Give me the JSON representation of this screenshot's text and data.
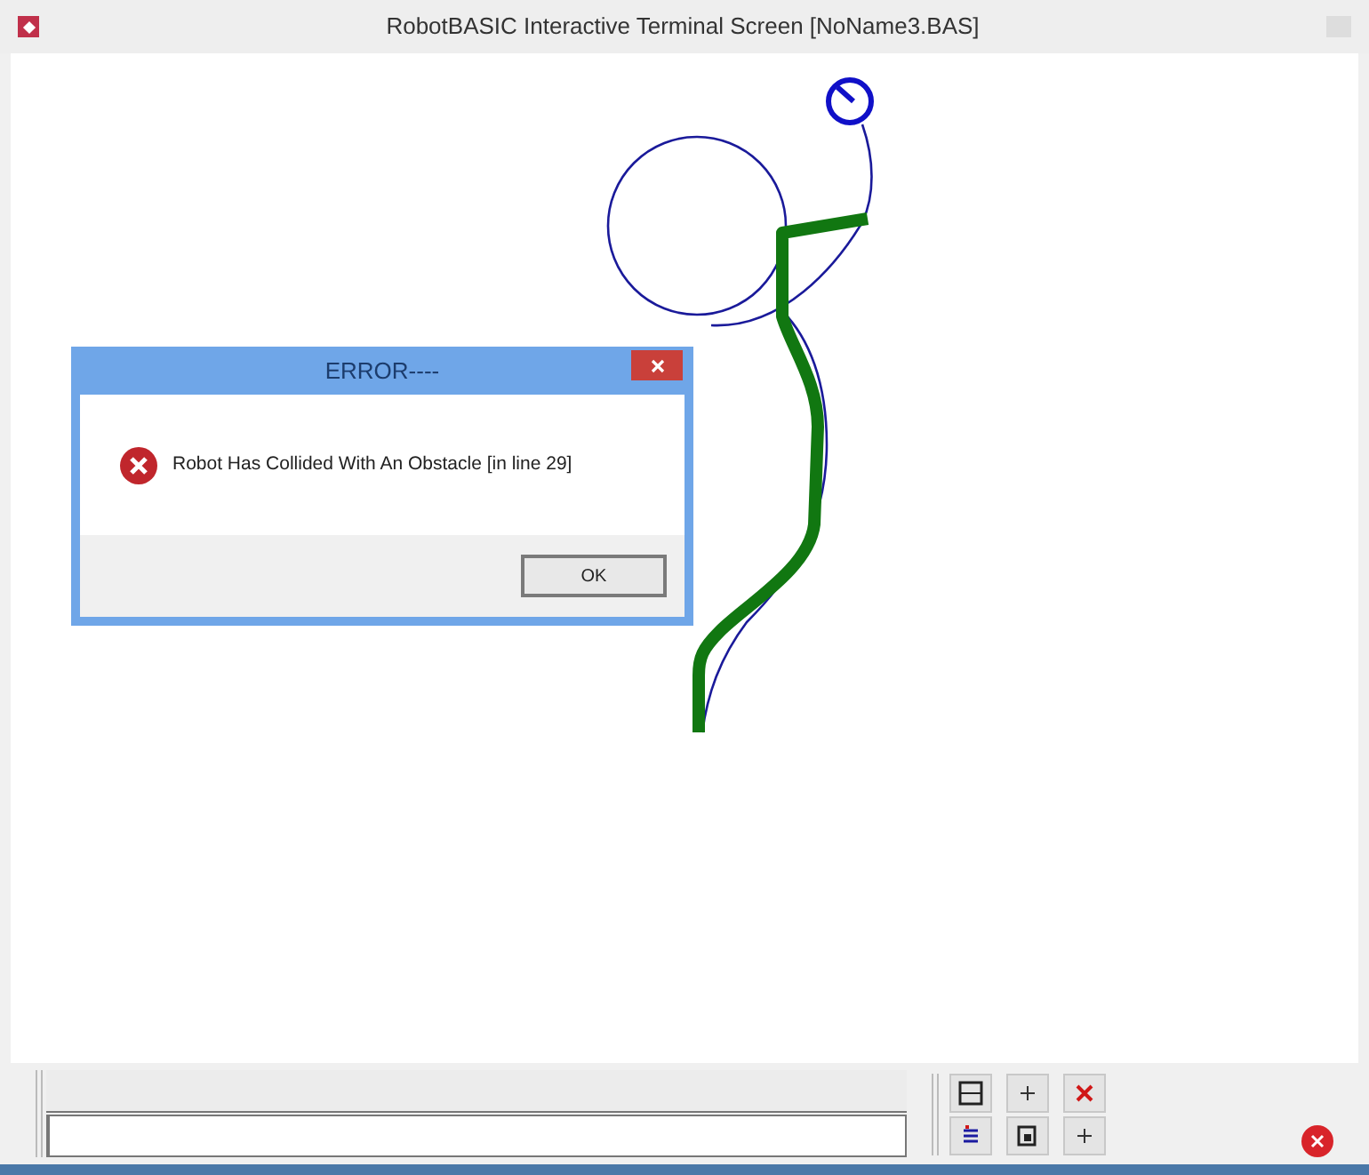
{
  "window": {
    "title": "RobotBASIC Interactive Terminal Screen  [NoName3.BAS]"
  },
  "dialog": {
    "title": "ERROR----",
    "message": "Robot Has Collided With An Obstacle [in line 29]",
    "buttons": [
      "OK"
    ]
  }
}
